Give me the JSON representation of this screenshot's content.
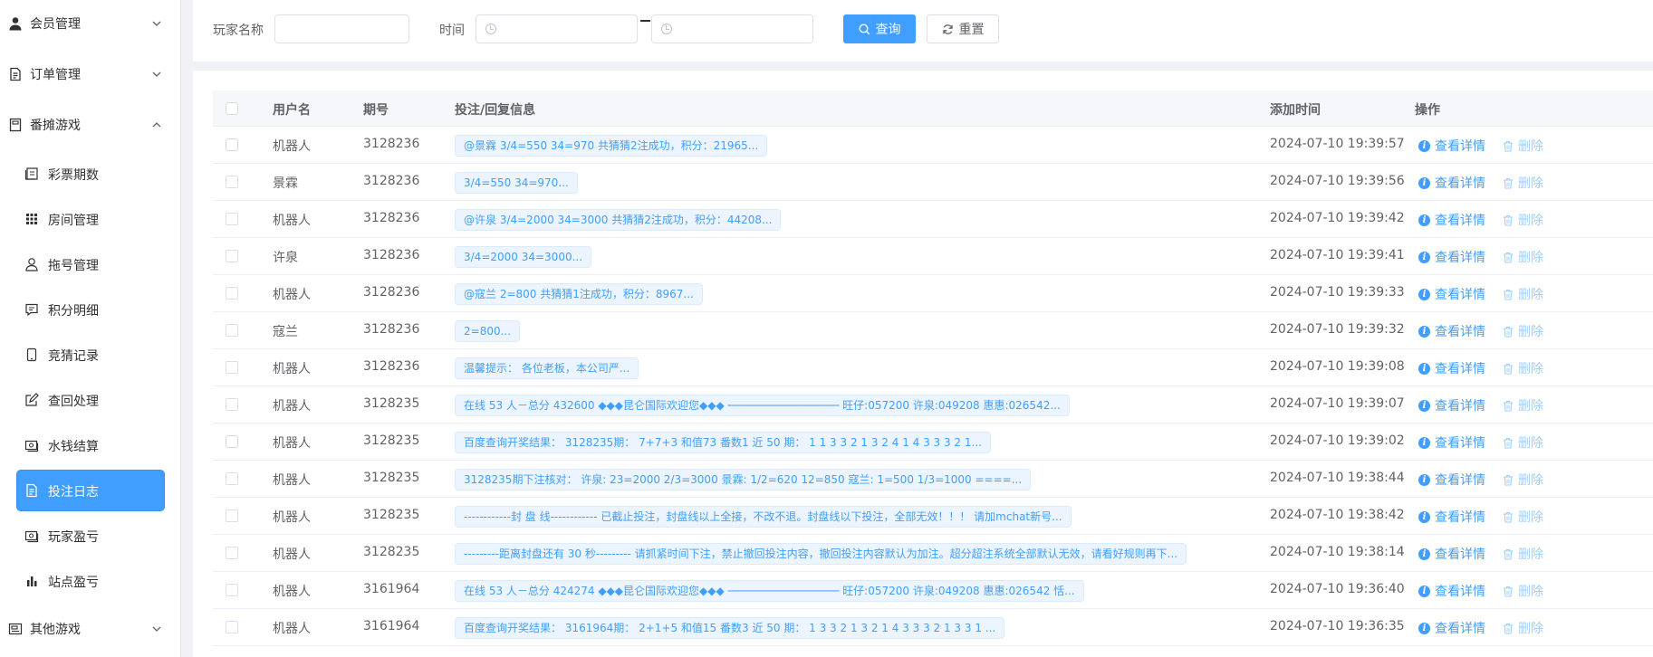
{
  "sidebar": {
    "groups": [
      {
        "label": "会员管理",
        "icon": "user-icon",
        "expanded": false
      },
      {
        "label": "订单管理",
        "icon": "document-icon",
        "expanded": false
      },
      {
        "label": "番摊游戏",
        "icon": "book-icon",
        "expanded": true
      },
      {
        "label": "其他游戏",
        "icon": "wallet-icon",
        "expanded": false
      }
    ],
    "items": [
      {
        "label": "彩票期数",
        "icon": "tickets-icon"
      },
      {
        "label": "房间管理",
        "icon": "grid-icon"
      },
      {
        "label": "拖号管理",
        "icon": "user-outline-icon"
      },
      {
        "label": "积分明细",
        "icon": "chat-icon"
      },
      {
        "label": "竞猜记录",
        "icon": "mobile-icon"
      },
      {
        "label": "查回处理",
        "icon": "edit-icon"
      },
      {
        "label": "水钱结算",
        "icon": "money-icon"
      },
      {
        "label": "投注日志",
        "icon": "document-icon"
      },
      {
        "label": "玩家盈亏",
        "icon": "money-icon"
      },
      {
        "label": "站点盈亏",
        "icon": "bar-chart-icon"
      }
    ],
    "active_item": "投注日志"
  },
  "search": {
    "player_label": "玩家名称",
    "player_value": "",
    "time_label": "时间",
    "start_value": "",
    "end_value": "",
    "query_label": "查询",
    "reset_label": "重置"
  },
  "table": {
    "headers": {
      "username": "用户名",
      "period": "期号",
      "message": "投注/回复信息",
      "time": "添加时间",
      "actions": "操作"
    },
    "detail_label": "查看详情",
    "delete_label": "删除",
    "rows": [
      {
        "username": "机器人",
        "period": "3128236",
        "message": "@景霖 3/4=550 34=970 共猜猜2注成功，积分：21965...",
        "time": "2024-07-10 19:39:57"
      },
      {
        "username": "景霖",
        "period": "3128236",
        "message": "3/4=550 34=970...",
        "time": "2024-07-10 19:39:56"
      },
      {
        "username": "机器人",
        "period": "3128236",
        "message": "@许泉 3/4=2000 34=3000 共猜猜2注成功，积分：44208...",
        "time": "2024-07-10 19:39:42"
      },
      {
        "username": "许泉",
        "period": "3128236",
        "message": "3/4=2000 34=3000...",
        "time": "2024-07-10 19:39:41"
      },
      {
        "username": "机器人",
        "period": "3128236",
        "message": "@寇兰 2=800 共猜猜1注成功，积分：8967...",
        "time": "2024-07-10 19:39:33"
      },
      {
        "username": "寇兰",
        "period": "3128236",
        "message": "2=800...",
        "time": "2024-07-10 19:39:32"
      },
      {
        "username": "机器人",
        "period": "3128236",
        "message": "温馨提示： 各位老板，本公司严...",
        "time": "2024-07-10 19:39:08"
      },
      {
        "username": "机器人",
        "period": "3128235",
        "message": "在线 53 人－总分 432600 ◆◆◆昆仑国际欢迎您◆◆◆ ───────────────── 旺仔:057200 许泉:049208 惠惠:026542...",
        "time": "2024-07-10 19:39:07"
      },
      {
        "username": "机器人",
        "period": "3128235",
        "message": "百度查询开奖结果： 3128235期： 7+7+3 和值73 番数1 近 50 期： 1 1 3 3 2 1 3 2 4 1 4 3 3 3 2 1...",
        "time": "2024-07-10 19:39:02"
      },
      {
        "username": "机器人",
        "period": "3128235",
        "message": "3128235期下注核对： 许泉: 23=2000 2/3=3000 景霖: 1/2=620 12=850 寇兰: 1=500 1/3=1000 ====...",
        "time": "2024-07-10 19:38:44"
      },
      {
        "username": "机器人",
        "period": "3128235",
        "message": "------------封 盘 线------------ 已截止投注，封盘线以上全接，不改不退。封盘线以下投注，全部无效！！！ 请加mchat新号...",
        "time": "2024-07-10 19:38:42"
      },
      {
        "username": "机器人",
        "period": "3128235",
        "message": "---------距离封盘还有 30 秒--------- 请抓紧时间下注，禁止撤回投注内容，撤回投注内容默认为加注。超分超注系统全部默认无效，请看好规则再下...",
        "time": "2024-07-10 19:38:14"
      },
      {
        "username": "机器人",
        "period": "3161964",
        "message": "在线 53 人－总分 424274 ◆◆◆昆仑国际欢迎您◆◆◆ ───────────────── 旺仔:057200 许泉:049208 惠惠:026542 恬...",
        "time": "2024-07-10 19:36:40"
      },
      {
        "username": "机器人",
        "period": "3161964",
        "message": "百度查询开奖结果： 3161964期： 2+1+5 和值15 番数3 近 50 期： 1 3 3 2 1 3 2 1 4 3 3 3 2 1 3 3 1 ...",
        "time": "2024-07-10 19:36:35"
      }
    ]
  }
}
